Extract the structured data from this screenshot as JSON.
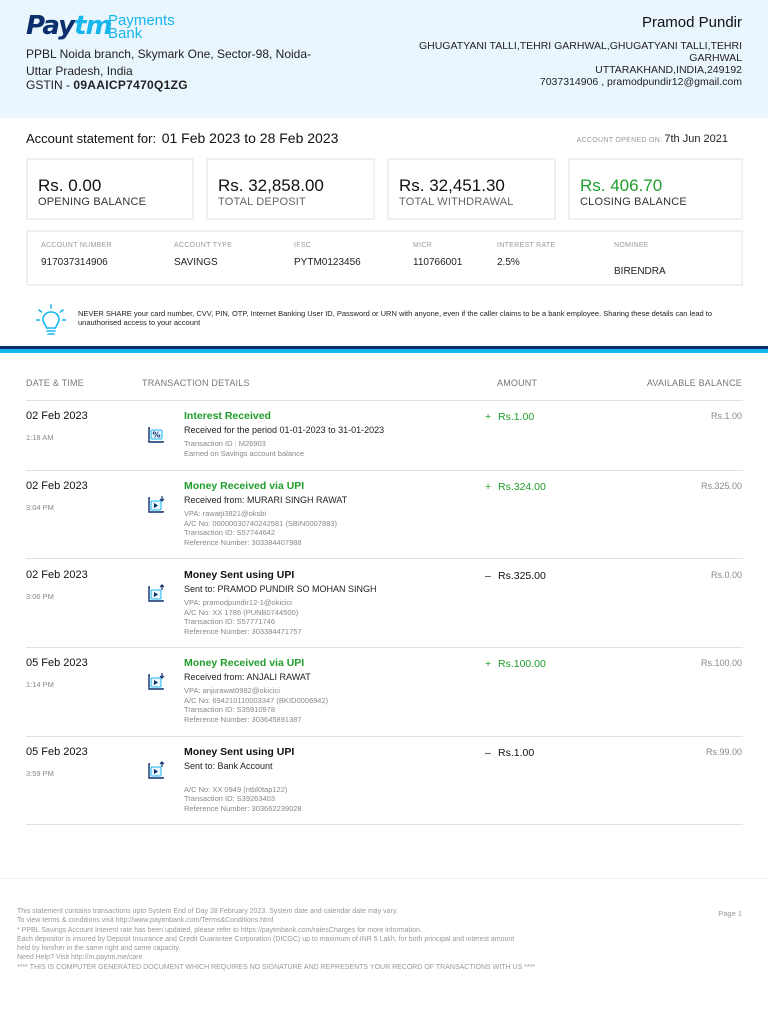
{
  "header": {
    "logo_pay": "Pay",
    "logo_tm": "tm",
    "logo_line1": "Payments",
    "logo_line2": "Bank",
    "branch_line1": "PPBL Noida branch, Skymark One, Sector-98, Noida-",
    "branch_line2": "Uttar Pradesh, India",
    "gstin_label": "GSTIN -",
    "gstin_value": "09AAICP7470Q1ZG",
    "customer_name": "Pramod Pundir",
    "customer_addr1": "GHUGATYANI TALLI,TEHRI GARHWAL,GHUGATYANI TALLI,TEHRI",
    "customer_addr2": "GARHWAL",
    "customer_addr3": "UTTARAKHAND,INDIA,249192",
    "customer_contact": "7037314906 , pramodpundir12@gmail.com"
  },
  "statement": {
    "label": "Account statement for:",
    "period": "01 Feb 2023 to 28 Feb 2023",
    "opened_label": "ACCOUNT OPENED ON:",
    "opened_value": "7th Jun 2021"
  },
  "balances": [
    {
      "amount": "Rs. 0.00",
      "label": "OPENING BALANCE"
    },
    {
      "amount": "Rs. 32,858.00",
      "label": "TOTAL DEPOSIT"
    },
    {
      "amount": "Rs. 32,451.30",
      "label": "TOTAL WITHDRAWAL"
    },
    {
      "amount": "Rs. 406.70",
      "label": "CLOSING BALANCE"
    }
  ],
  "account_details": [
    {
      "key": "ACCOUNT NUMBER",
      "value": "917037314906"
    },
    {
      "key": "ACCOUNT TYPE",
      "value": "SAVINGS"
    },
    {
      "key": "IFSC",
      "value": "PYTM0123456"
    },
    {
      "key": "MICR",
      "value": "110766001"
    },
    {
      "key": "INTEREST RATE",
      "value": "2.5%"
    },
    {
      "key": "NOMINEE",
      "value": "BIRENDRA"
    }
  ],
  "warning": {
    "icon": "lightbulb-icon",
    "text": "NEVER SHARE your card number, CVV, PIN, OTP, Internet Banking User ID, Password or URN with anyone, even if the caller claims to be a bank employee. Sharing these details can lead to unauthorised access to your account"
  },
  "table": {
    "headers": [
      "DATE & TIME",
      "TRANSACTION DETAILS",
      "AMOUNT",
      "AVAILABLE BALANCE"
    ],
    "rows": [
      {
        "date": "02 Feb 2023",
        "time": "1:18 AM",
        "icon": "interest-percent-icon",
        "title": "Interest Received",
        "direction": "in",
        "desc": "Received for the period 01-01-2023 to 31-01-2023",
        "meta": [
          "Transaction ID : M26903",
          "Earned on Savings account balance"
        ],
        "sign": "+",
        "amount": "Rs.1.00",
        "balance": "Rs.1.00"
      },
      {
        "date": "02 Feb 2023",
        "time": "3:04 PM",
        "icon": "upi-receive-icon",
        "title": "Money Received via UPI",
        "direction": "in",
        "desc": "Received from: MURARI SINGH RAWAT",
        "meta": [
          "VPA: rawatji3821@oksbi",
          "A/C No: 00000030740242581 (SBIN0007883)",
          "Transaction ID: S57744642",
          "Reference Number: 303384407988"
        ],
        "sign": "+",
        "amount": "Rs.324.00",
        "balance": "Rs.325.00"
      },
      {
        "date": "02 Feb 2023",
        "time": "3:06 PM",
        "icon": "upi-send-icon",
        "title": "Money Sent using UPI",
        "direction": "out",
        "desc": "Sent to: PRAMOD PUNDIR SO MOHAN SINGH",
        "meta": [
          "VPA: pramodpundir12-1@okicici",
          "A/C No: XX 1786 (PUNB0744500)",
          "Transaction ID: S57771746",
          "Reference Number: 303384471757"
        ],
        "sign": "–",
        "amount": "Rs.325.00",
        "balance": "Rs.0.00"
      },
      {
        "date": "05 Feb 2023",
        "time": "1:14 PM",
        "icon": "upi-receive-icon",
        "title": "Money Received via UPI",
        "direction": "in",
        "desc": "Received from: ANJALI RAWAT",
        "meta": [
          "VPA: anjurawat0982@okicici",
          "A/C No: 694210110003347 (BKID0006942)",
          "Transaction ID: S35910978",
          "Reference Number: 303645891387"
        ],
        "sign": "+",
        "amount": "Rs.100.00",
        "balance": "Rs.100.00"
      },
      {
        "date": "05 Feb 2023",
        "time": "3:59 PM",
        "icon": "upi-send-icon",
        "title": "Money Sent using UPI",
        "direction": "out",
        "desc": "Sent to: Bank Account",
        "meta": [
          "",
          "A/C No: XX 0949 (ntbl0tap122)",
          "Transaction ID: S39263403",
          "Reference Number: 303662239028"
        ],
        "sign": "–",
        "amount": "Rs.1.00",
        "balance": "Rs.99.00"
      }
    ]
  },
  "footer": {
    "lines": [
      "This statement contains transactions upto System End of Day 28 February 2023. System date and calendar date may vary.",
      "To view terms & conditions visit http://www.paytmbank.com/Terms&Conditions.html",
      "* PPBL Savings Account Interest rate has been updated, please refer to https://paytmbank.com/ratesCharges for more information.",
      "Each depositor is insured by Deposit Insurance and Credit Guarantee Corporation (DICGC) up to maximum of INR 5 Lakh, for both principal and interest amount",
      "held by him/her in the same right and same capacity.",
      "Need Help? Visit http://m.paytm.me/care",
      "**** THIS IS COMPUTER GENERATED DOCUMENT WHICH REQUIRES NO SIGNATURE AND REPRESENTS YOUR RECORD OF TRANSACTIONS WITH US ****"
    ],
    "page": "Page 1"
  },
  "colors": {
    "navy": "#0d2e6d",
    "sky": "#17b6ef",
    "credit_green": "#1f9d2a",
    "header_bg": "#eaf6fd"
  }
}
